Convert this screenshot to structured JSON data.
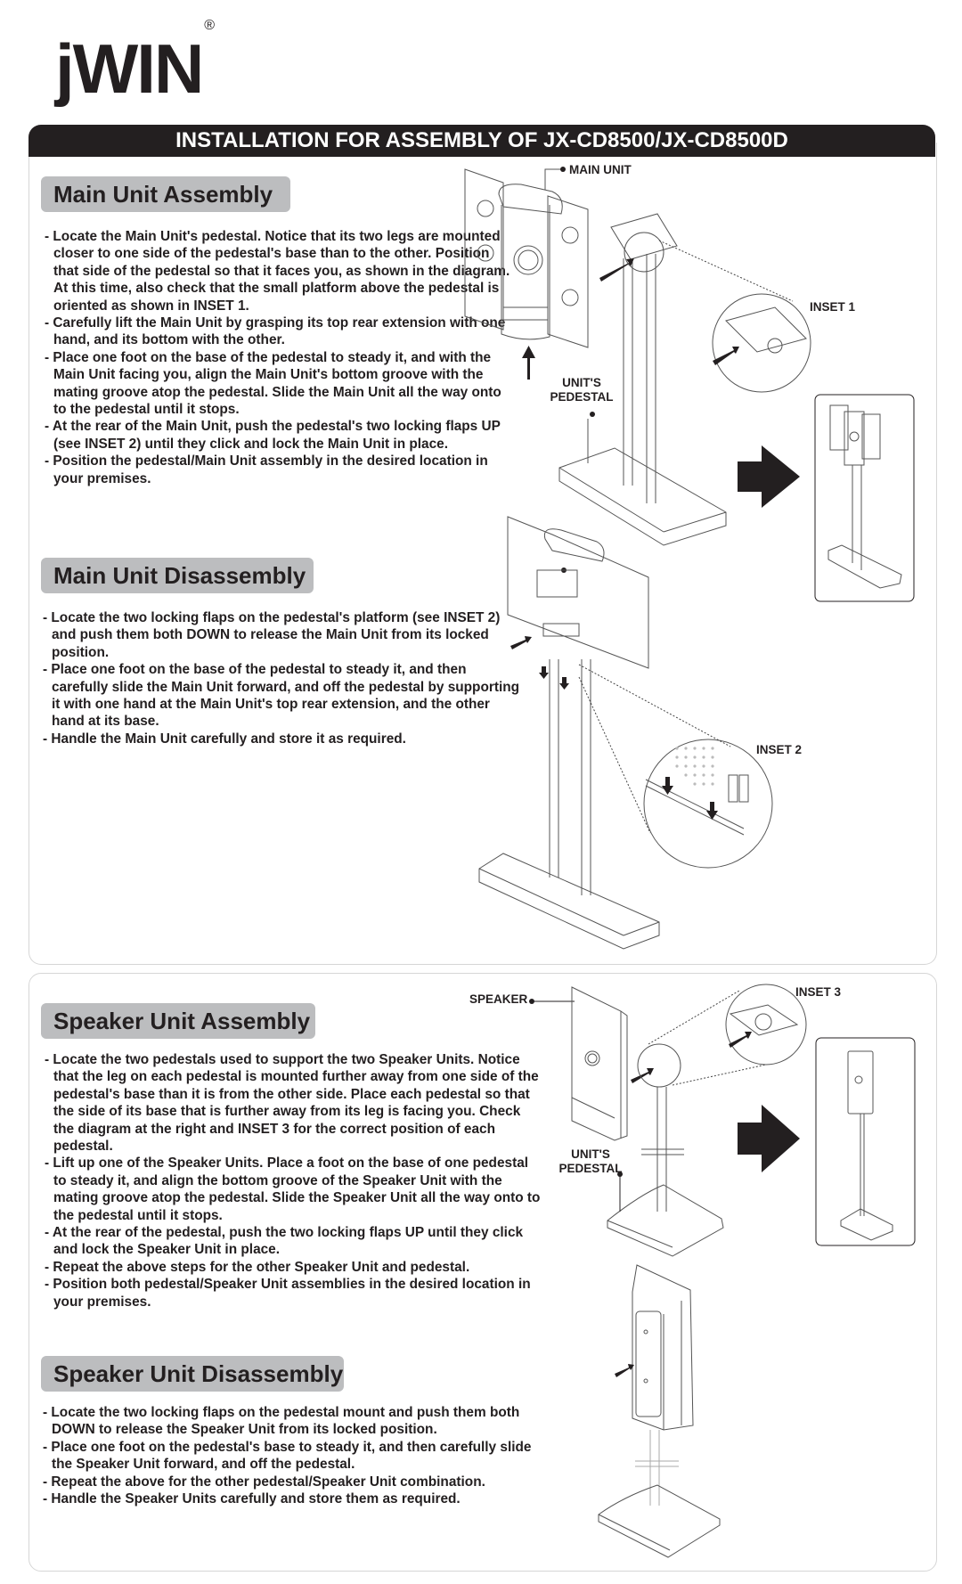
{
  "brand": {
    "logo_text": "jWIN",
    "registered_mark": "®"
  },
  "header": {
    "title": "INSTALLATION FOR ASSEMBLY OF JX-CD8500/JX-CD8500D"
  },
  "sections": {
    "main_assembly": {
      "title": "Main Unit Assembly",
      "steps": [
        "Locate the Main Unit's pedestal. Notice that its two legs are mounted closer to one side of the pedestal's base than to the other. Position that side of the pedestal so that it faces you, as shown in the diagram. At this time, also check that the small platform above the pedestal is oriented as shown in INSET 1.",
        "Carefully lift the Main Unit by grasping its top rear extension with one hand, and its bottom with the other.",
        "Place one foot on the base of the pedestal to steady it, and with the Main Unit facing you, align the Main Unit's bottom groove with the mating groove atop the pedestal. Slide the Main Unit all the way onto to the pedestal until it stops.",
        "At the rear of the Main Unit, push the pedestal's two locking flaps UP (see INSET 2) until they click and lock the Main Unit in place.",
        "Position the pedestal/Main Unit assembly in the desired location in your premises."
      ]
    },
    "main_disassembly": {
      "title": "Main Unit Disassembly",
      "steps": [
        "Locate the two locking flaps on the pedestal's platform (see INSET 2) and push them both DOWN to release the Main Unit from its locked position.",
        "Place one foot on the base of the pedestal to steady it, and then carefully slide the Main Unit forward, and off the pedestal by supporting it with one hand at the Main Unit's top rear extension, and the other hand at its base.",
        "Handle the Main Unit carefully and store it as required."
      ]
    },
    "speaker_assembly": {
      "title": "Speaker Unit Assembly",
      "steps": [
        "Locate the two pedestals used to support the two Speaker Units. Notice that the leg on each pedestal is mounted further away from one side of the pedestal's base than it is from the other side. Place each pedestal so that the side of its base that is further away from its leg is facing you. Check the diagram at the right and INSET 3 for the correct position of each pedestal.",
        "Lift up one of the Speaker Units. Place a foot on the base of one pedestal to steady it, and align the bottom groove of the Speaker Unit with the mating groove atop the pedestal. Slide the Speaker Unit all the way onto to the pedestal until it stops.",
        "At the rear of the pedestal, push the two locking flaps UP until they click and lock the Speaker Unit in place.",
        "Repeat the above steps for the other Speaker Unit and pedestal.",
        "Position both pedestal/Speaker Unit assemblies in the desired location in your premises."
      ]
    },
    "speaker_disassembly": {
      "title": "Speaker Unit Disassembly",
      "steps": [
        "Locate the two locking flaps on the pedestal mount and push them both DOWN to release the Speaker Unit from its locked position.",
        "Place one foot on the pedestal's base to steady it, and then carefully slide the Speaker Unit forward, and off the pedestal.",
        "Repeat the above for the other pedestal/Speaker Unit combination.",
        "Handle the Speaker Units carefully and store them as required."
      ]
    }
  },
  "diagram_labels": {
    "main_unit": "MAIN UNIT",
    "inset1": "INSET 1",
    "inset2": "INSET 2",
    "inset3": "INSET 3",
    "units_pedestal_line1": "UNIT'S",
    "units_pedestal_line2": "PEDESTAL",
    "speaker": "SPEAKER"
  }
}
